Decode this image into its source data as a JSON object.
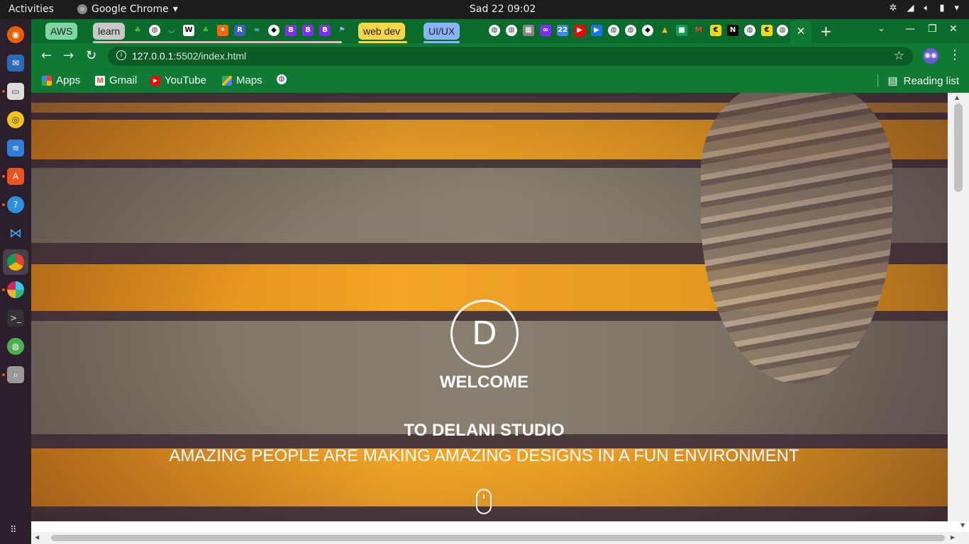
{
  "topbar": {
    "activities": "Activities",
    "app_name": "Google Chrome",
    "clock": "Sad 22  09:02"
  },
  "tab_groups": [
    {
      "label": "AWS",
      "color": "#7ed6a0"
    },
    {
      "label": "learn",
      "color": "#c8c8c8"
    },
    {
      "label": "web dev",
      "color": "#f9d648"
    },
    {
      "label": "UI/UX",
      "color": "#8ab4f8"
    }
  ],
  "active_tab": {
    "close": "✕"
  },
  "new_tab": "+",
  "toolbar": {
    "url_host": "127.0.0.1",
    "url_path": ":5502/index.html"
  },
  "bookmarks": [
    {
      "label": "Apps",
      "icon": "apps-grid-icon"
    },
    {
      "label": "Gmail",
      "icon": "gmail-icon"
    },
    {
      "label": "YouTube",
      "icon": "youtube-icon"
    },
    {
      "label": "Maps",
      "icon": "maps-icon"
    }
  ],
  "reading_list": "Reading list",
  "hero": {
    "logo_letter": "D",
    "welcome": "WELCOME",
    "studio": "TO DELANI STUDIO",
    "tagline": "AMAZING PEOPLE ARE MAKING AMAZING DESIGNS IN A FUN ENVIRONMENT"
  },
  "colors": {
    "chrome_frame": "#0b6b2c",
    "chrome_toolbar": "#0f7a33",
    "stripe_orange": "#f2a526"
  }
}
